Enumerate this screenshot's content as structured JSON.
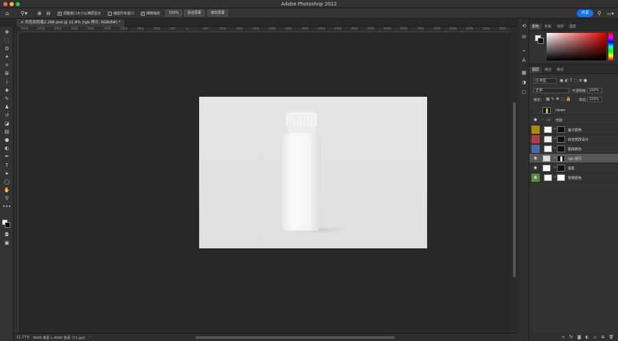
{
  "app": {
    "title": "Adobe Photoshop 2022"
  },
  "options": {
    "resize_windows": "调整窗口大小以满屏显示",
    "zoom_all": "缩放所有窗口",
    "scrubby_zoom": "细微缩放",
    "zoom_value": "100%",
    "fit_screen": "适合屏幕",
    "fill_screen": "填充屏幕",
    "share": "共享"
  },
  "document": {
    "tab_title": "白色农药瓶2.266.psd @ 11.8% (rgb 拷贝, RGB/8#) *",
    "zoom": "11.77%",
    "dims": "6000 像素 x 4000 像素 (72 ppi)"
  },
  "ruler": {
    "ticks": [
      "5000",
      "4500",
      "4000",
      "3500",
      "3000",
      "2500",
      "2000",
      "1500",
      "1000",
      "500",
      "0",
      "500",
      "1000",
      "1500",
      "2000",
      "2500",
      "3000",
      "3500",
      "4000",
      "4500",
      "5000",
      "5500",
      "6000",
      "6500",
      "7000",
      "7500",
      "8000",
      "8500",
      "9000",
      "9500"
    ]
  },
  "color_panel": {
    "tabs": [
      "颜色",
      "色板",
      "渐变",
      "图案"
    ]
  },
  "layers_panel": {
    "tabs": [
      "图层",
      "通道",
      "路径"
    ],
    "filter_kind": "Q 类型",
    "blend_mode": "正常",
    "opacity_label": "不透明度:",
    "opacity_value": "100%",
    "lock_label": "锁定:",
    "fill_label": "填充:",
    "fill_value": "100%",
    "layers": [
      {
        "name": "clown",
        "visible": false,
        "color": "",
        "selected": false
      },
      {
        "name": "光效",
        "visible": true,
        "color": "",
        "selected": false
      },
      {
        "name": "盖子颜色",
        "visible": false,
        "color": "#a38b14",
        "selected": false
      },
      {
        "name": "双击修改设计",
        "visible": false,
        "color": "#b13d3d",
        "selected": false
      },
      {
        "name": "瓶体颜色",
        "visible": false,
        "color": "#4a69a6",
        "selected": false
      },
      {
        "name": "rgb 拷贝",
        "visible": true,
        "color": "",
        "selected": true
      },
      {
        "name": "投影",
        "visible": true,
        "color": "",
        "selected": false
      },
      {
        "name": "背景颜色",
        "visible": true,
        "color": "#5a8a3a",
        "selected": false
      }
    ]
  },
  "colors": {
    "accent": "#1473e6",
    "share_text": "#ffffff"
  }
}
